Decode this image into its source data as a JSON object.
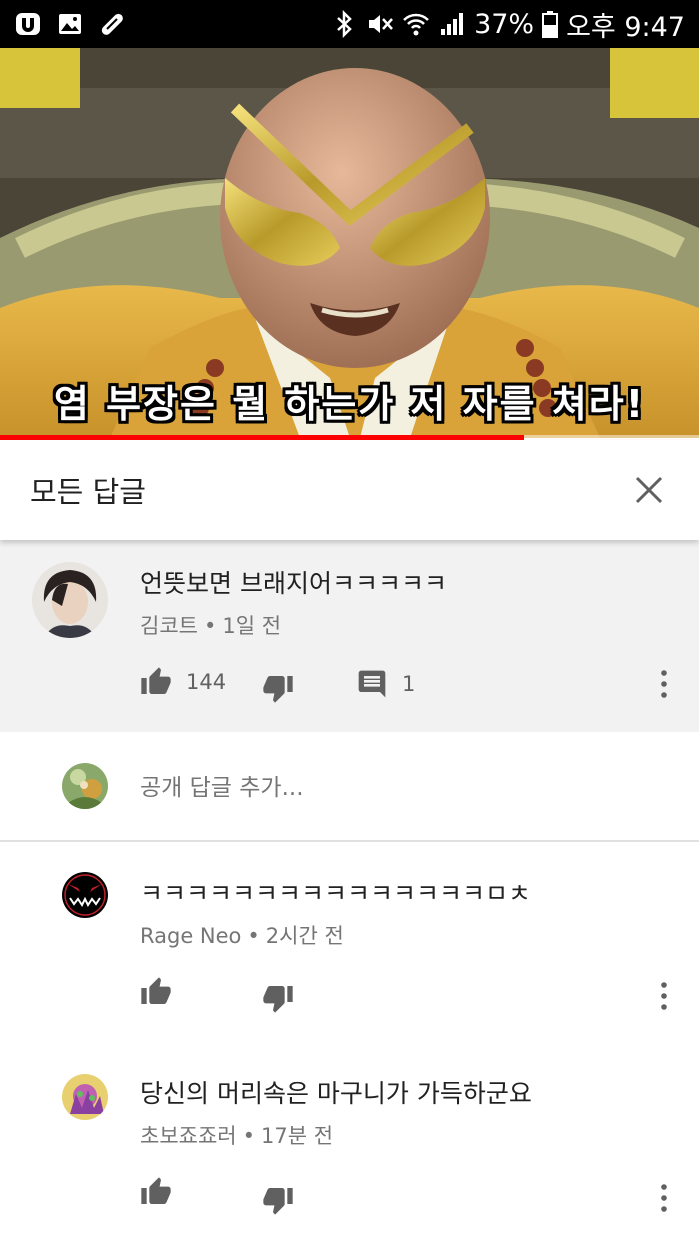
{
  "status_bar": {
    "battery": "37%",
    "time": "오후 9:47"
  },
  "video": {
    "subtitle": "염 부장은 뭘 하는가 저 자를 쳐라!",
    "progress": 0.75
  },
  "panel": {
    "title": "모든 답글"
  },
  "main_comment": {
    "text": "언뜻보면 브래지어ㅋㅋㅋㅋㅋ",
    "author": "김코트",
    "time": "1일 전",
    "likes": "144",
    "replies": "1"
  },
  "reply_input": {
    "placeholder": "공개 답글 추가..."
  },
  "replies": [
    {
      "text": "ㅋㅋㅋㅋㅋㅋㅋㅋㅋㅋㅋㅋㅋㅋㅋㅁㅊ",
      "author": "Rage Neo",
      "time": "2시간 전"
    },
    {
      "text": "당신의 머리속은 마구니가 가득하군요",
      "author": "초보죠죠러",
      "time": "17분 전"
    }
  ],
  "meta_separator": "•",
  "colors": {
    "progress": "#ff0000",
    "meta_text": "#757575",
    "main_comment_bg": "#f2f2f2"
  }
}
